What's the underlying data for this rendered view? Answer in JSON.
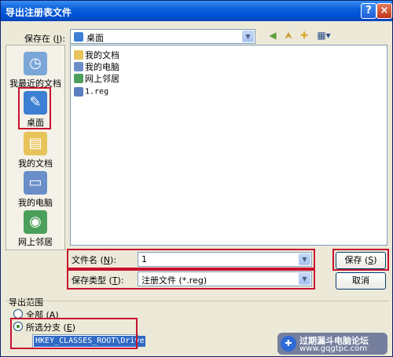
{
  "window": {
    "title": "导出注册表文件",
    "help_icon": "?",
    "close_icon": "×"
  },
  "save_in": {
    "label_prefix": "保存在 (",
    "hotkey": "I",
    "label_suffix": "):",
    "value": "桌面"
  },
  "toolbar": {
    "icons": [
      "back-icon",
      "up-folder-icon",
      "new-folder-icon",
      "view-menu-icon"
    ]
  },
  "places": [
    {
      "label": "我最近的文档",
      "icon": "recent-documents-icon",
      "color": "#7aa7d8"
    },
    {
      "label": "桌面",
      "icon": "desktop-icon",
      "color": "#3c7fd3"
    },
    {
      "label": "我的文档",
      "icon": "my-documents-icon",
      "color": "#e8c35a"
    },
    {
      "label": "我的电脑",
      "icon": "my-computer-icon",
      "color": "#6a8fc8"
    },
    {
      "label": "网上邻居",
      "icon": "network-places-icon",
      "color": "#4aa05a"
    }
  ],
  "files": [
    {
      "name": "我的文档",
      "icon": "folder-icon",
      "color": "#e8c35a"
    },
    {
      "name": "我的电脑",
      "icon": "computer-icon",
      "color": "#6a8fc8"
    },
    {
      "name": "网上邻居",
      "icon": "network-icon",
      "color": "#4aa05a"
    },
    {
      "name": "1.reg",
      "icon": "reg-file-icon",
      "color": "#5a7fc0"
    }
  ],
  "filename": {
    "label_prefix": "文件名 (",
    "hotkey": "N",
    "label_suffix": "):",
    "value": "1"
  },
  "filetype": {
    "label_prefix": "保存类型 (",
    "hotkey": "T",
    "label_suffix": "):",
    "value": "注册文件 (*.reg)"
  },
  "buttons": {
    "save_prefix": "保存 (",
    "save_hotkey": "S",
    "save_suffix": ")",
    "cancel": "取消"
  },
  "export_range": {
    "title": "导出范围",
    "all_prefix": "全部 (",
    "all_hotkey": "A",
    "all_suffix": ")",
    "branch_prefix": "所选分支 (",
    "branch_hotkey": "E",
    "branch_suffix": ")",
    "branch_value": "HKEY_CLASSES_ROOT\\Drive",
    "selected": "branch"
  },
  "watermark": {
    "text": "过期漏斗电脑论坛",
    "url": "www.gqgtpc.com"
  },
  "colors": {
    "highlight": "#c8102e",
    "title_bar": "#0a5fd8",
    "selection": "#316ac5"
  }
}
